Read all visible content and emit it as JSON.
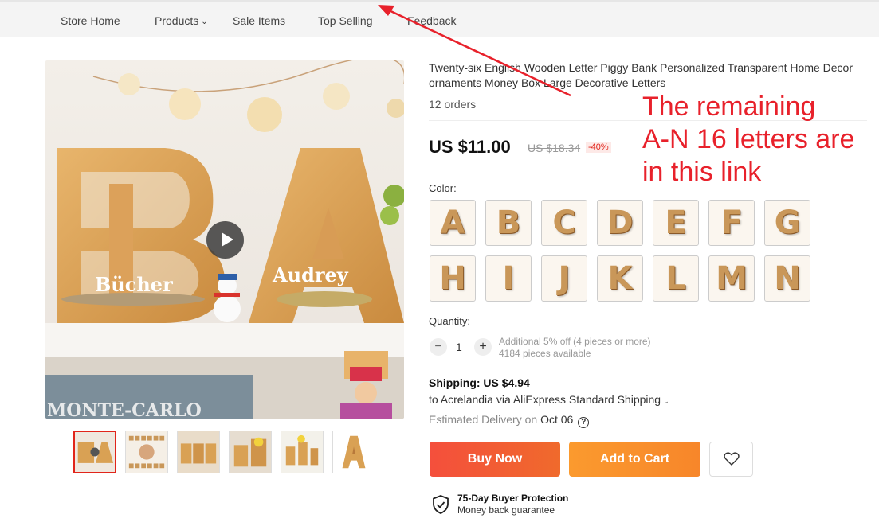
{
  "nav": {
    "items": [
      "Store Home",
      "Products",
      "Sale Items",
      "Top Selling",
      "Feedback"
    ]
  },
  "product": {
    "title": "Twenty-six English Wooden Letter Piggy Bank Personalized Transparent Home Decor ornaments Money Box Large Decorative Letters",
    "orders": "12 orders",
    "price": "US $11.00",
    "original_price": "US $18.34",
    "discount": "-40%",
    "color_label": "Color:",
    "color_options": [
      "A",
      "B",
      "C",
      "D",
      "E",
      "F",
      "G",
      "H",
      "I",
      "J",
      "K",
      "L",
      "M",
      "N"
    ],
    "quantity_label": "Quantity:",
    "quantity_minus": "−",
    "quantity_plus": "+",
    "quantity": "1",
    "quantity_discount": "Additional 5% off (4 pieces or more)",
    "stock": "4184 pieces available",
    "shipping_title": "Shipping: US $4.94",
    "shipping_dest": "to Acrelandia via AliExpress Standard Shipping",
    "delivery_prefix": "Estimated Delivery on",
    "delivery_date": "Oct 06",
    "buy_now": "Buy Now",
    "add_to_cart": "Add to Cart",
    "protection_title": "75-Day Buyer Protection",
    "protection_sub": "Money back guarantee"
  },
  "gallery": {
    "thumb_count": 6,
    "active_thumb": 0,
    "image_text": [
      "Bücher",
      "Audrey",
      "MONTE-CARLO"
    ]
  },
  "annotation": {
    "lines": [
      "The remaining",
      "A-N 16 letters are",
      "in this link"
    ],
    "color": "#e8212b"
  },
  "colors": {
    "accent_red": "#e1251b",
    "buy_now": "#f44f3c",
    "add_to_cart": "#fb9a2e",
    "wood": "#c99759"
  }
}
